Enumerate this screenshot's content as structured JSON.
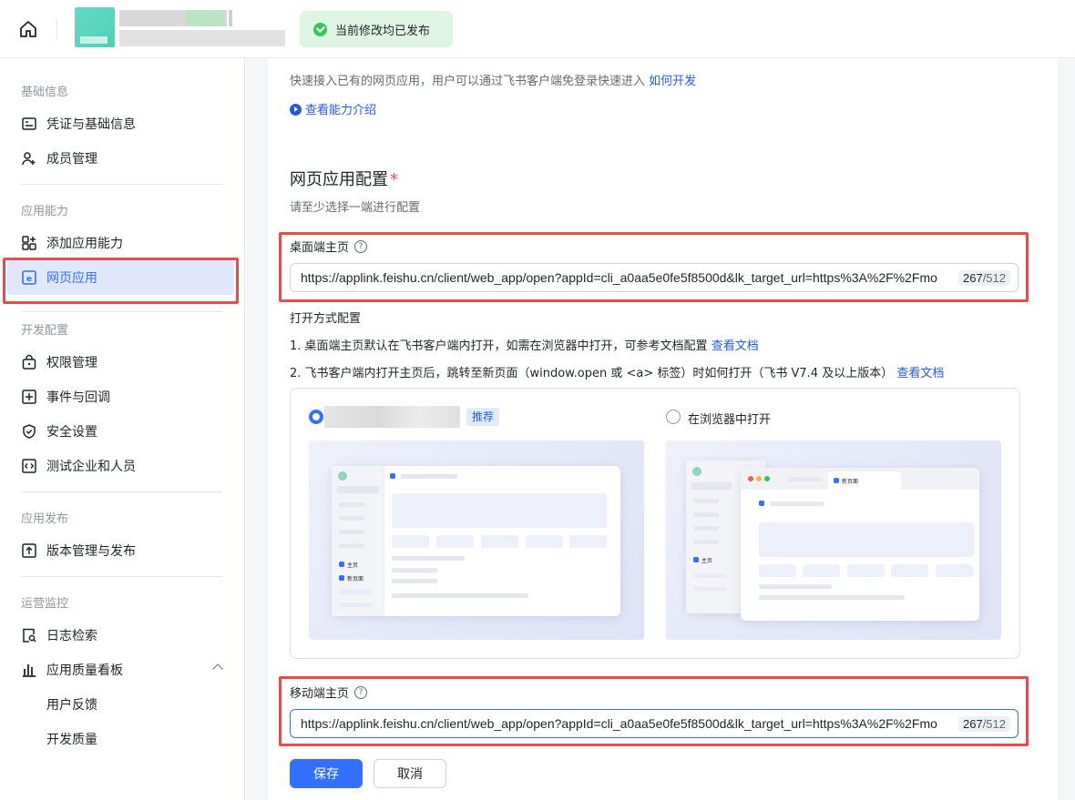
{
  "toast": {
    "text": "当前修改均已发布"
  },
  "sidebar": {
    "sections": [
      {
        "title": "基础信息",
        "items": [
          {
            "label": "凭证与基础信息",
            "icon": "credential-icon"
          },
          {
            "label": "成员管理",
            "icon": "user-add-icon"
          }
        ]
      },
      {
        "title": "应用能力",
        "items": [
          {
            "label": "添加应用能力",
            "icon": "add-app-icon"
          },
          {
            "label": "网页应用",
            "icon": "web-app-icon",
            "active": true
          }
        ]
      },
      {
        "title": "开发配置",
        "items": [
          {
            "label": "权限管理",
            "icon": "lock-icon"
          },
          {
            "label": "事件与回调",
            "icon": "event-icon"
          },
          {
            "label": "安全设置",
            "icon": "shield-icon"
          },
          {
            "label": "测试企业和人员",
            "icon": "code-icon"
          }
        ]
      },
      {
        "title": "应用发布",
        "items": [
          {
            "label": "版本管理与发布",
            "icon": "upload-icon"
          }
        ]
      },
      {
        "title": "运营监控",
        "items": [
          {
            "label": "日志检索",
            "icon": "log-search-icon"
          },
          {
            "label": "应用质量看板",
            "icon": "chart-icon"
          },
          {
            "label": "用户反馈"
          },
          {
            "label": "开发质量"
          }
        ]
      }
    ]
  },
  "main": {
    "intro": "快速接入已有的网页应用，用户可以通过飞书客户端免登录快速进入",
    "intro_link": "如何开发",
    "view_capability": "查看能力介绍",
    "config_title": "网页应用配置",
    "config_required": "*",
    "config_hint": "请至少选择一端进行配置",
    "desktop": {
      "label": "桌面端主页",
      "help": "?",
      "value": "https://applink.feishu.cn/client/web_app/open?appId=cli_a0aa5e0fe5f8500d&lk_target_url=https%3A%2F%2Fmo",
      "count": "267",
      "max": "/512"
    },
    "open_mode": {
      "title": "打开方式配置",
      "line1": "1. 桌面端主页默认在飞书客户端内打开，如需在浏览器中打开，可参考文档配置",
      "line1_link": "查看文档",
      "line2": "2. 飞书客户端内打开主页后，跳转至新页面（window.open 或 <a> 标签）时如何打开（飞书 V7.4 及以上版本）",
      "line2_link": "查看文档",
      "option1_badge": "推荐",
      "option2_label": "在浏览器中打开",
      "preview": {
        "home": "主页",
        "new_page": "新页面"
      }
    },
    "mobile": {
      "label": "移动端主页",
      "help": "?",
      "value": "https://applink.feishu.cn/client/web_app/open?appId=cli_a0aa5e0fe5f8500d&lk_target_url=https%3A%2F%2Fmo",
      "count": "267",
      "max": "/512"
    },
    "save_label": "保存",
    "cancel_label": "取消"
  },
  "colors": {
    "primary": "#3370ff",
    "link": "#245bdb",
    "success": "#34c759",
    "highlight_box": "#e34d4d",
    "active_bg": "#e1e8fd"
  }
}
